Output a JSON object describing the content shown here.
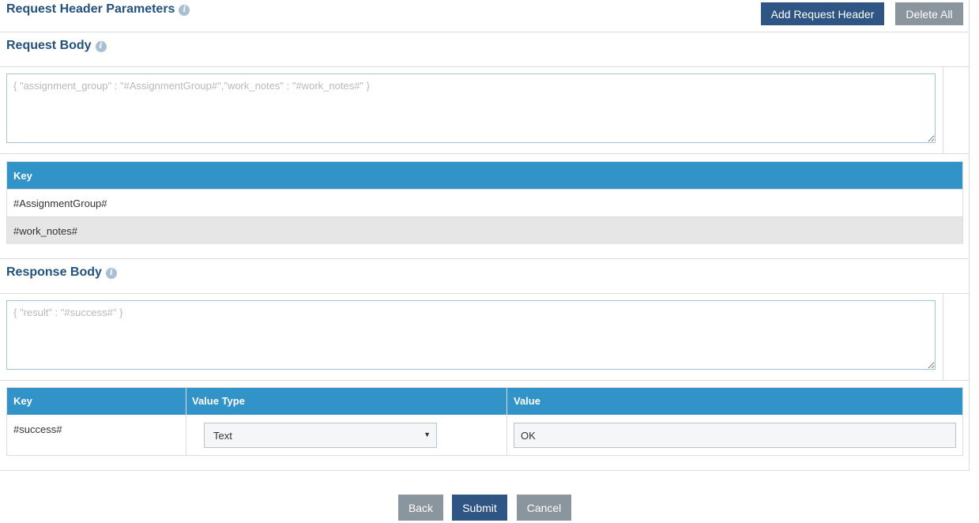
{
  "request_header": {
    "title": "Request Header Parameters",
    "add_label": "Add Request Header",
    "delete_all_label": "Delete All"
  },
  "request_body": {
    "title": "Request Body",
    "placeholder": "{ \"assignment_group\" : \"#AssignmentGroup#\",\"work_notes\" : \"#work_notes#\" }",
    "table": {
      "header_key": "Key",
      "rows": [
        "#AssignmentGroup#",
        "#work_notes#"
      ]
    }
  },
  "response_body": {
    "title": "Response Body",
    "placeholder": "{ \"result\" : \"#success#\" }",
    "table": {
      "header_key": "Key",
      "header_value_type": "Value Type",
      "header_value": "Value",
      "rows": [
        {
          "key": "#success#",
          "value_type": "Text",
          "value": "OK"
        }
      ]
    }
  },
  "footer": {
    "back_label": "Back",
    "submit_label": "Submit",
    "cancel_label": "Cancel"
  },
  "colors": {
    "header_blue": "#3193c8",
    "primary_button": "#2e5584",
    "secondary_button": "#8b959e",
    "section_title": "#23527c"
  },
  "icons": {
    "info": "info-icon",
    "dropdown": "dropdown-arrow-icon"
  }
}
